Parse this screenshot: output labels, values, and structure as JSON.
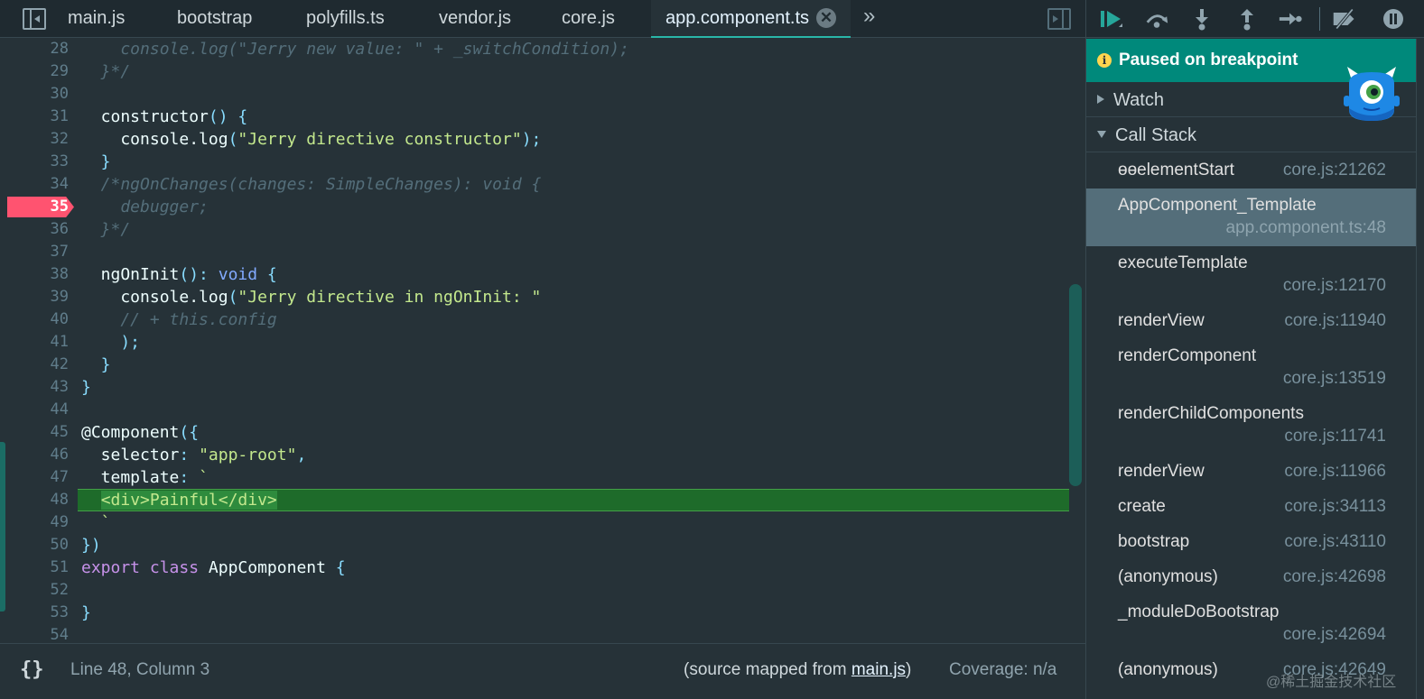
{
  "tabs": [
    {
      "label": "main.js"
    },
    {
      "label": "bootstrap"
    },
    {
      "label": "polyfills.ts"
    },
    {
      "label": "vendor.js"
    },
    {
      "label": "core.js"
    },
    {
      "label": "app.component.ts",
      "active": true,
      "close": "✕"
    }
  ],
  "tabs_more": "»",
  "editor": {
    "breakpoint_line": 35,
    "current_line": 48,
    "lines": [
      {
        "n": "28",
        "tokens": [
          [
            "cm",
            "    console.log(\"Jerry new value: \" + _switchCondition);"
          ]
        ]
      },
      {
        "n": "29",
        "tokens": [
          [
            "cm",
            "  }*/"
          ]
        ]
      },
      {
        "n": "30",
        "tokens": []
      },
      {
        "n": "31",
        "tokens": [
          [
            "fn",
            "  constructor"
          ],
          [
            "pn",
            "() {"
          ]
        ]
      },
      {
        "n": "32",
        "tokens": [
          [
            "fn",
            "    console.log"
          ],
          [
            "pn",
            "("
          ],
          [
            "str",
            "\"Jerry directive constructor\""
          ],
          [
            "pn",
            ");"
          ]
        ]
      },
      {
        "n": "33",
        "tokens": [
          [
            "pn",
            "  }"
          ]
        ]
      },
      {
        "n": "34",
        "tokens": [
          [
            "cm",
            "  /*ngOnChanges(changes: SimpleChanges): void {"
          ]
        ]
      },
      {
        "n": "35",
        "tokens": [
          [
            "cm",
            "    debugger;"
          ]
        ]
      },
      {
        "n": "36",
        "tokens": [
          [
            "cm",
            "  }*/"
          ]
        ]
      },
      {
        "n": "37",
        "tokens": []
      },
      {
        "n": "38",
        "tokens": [
          [
            "fn",
            "  ngOnInit"
          ],
          [
            "pn",
            "(): "
          ],
          [
            "ty",
            "void"
          ],
          [
            "pn",
            " {"
          ]
        ]
      },
      {
        "n": "39",
        "tokens": [
          [
            "fn",
            "    console.log"
          ],
          [
            "pn",
            "("
          ],
          [
            "str",
            "\"Jerry directive in ngOnInit: \""
          ]
        ]
      },
      {
        "n": "40",
        "tokens": [
          [
            "cm",
            "    // + this.config"
          ]
        ]
      },
      {
        "n": "41",
        "tokens": [
          [
            "pn",
            "    );"
          ]
        ]
      },
      {
        "n": "42",
        "tokens": [
          [
            "pn",
            "  }"
          ]
        ]
      },
      {
        "n": "43",
        "tokens": [
          [
            "pn",
            "}"
          ]
        ]
      },
      {
        "n": "44",
        "tokens": []
      },
      {
        "n": "45",
        "tokens": [
          [
            "fn",
            "@Component"
          ],
          [
            "pn",
            "({"
          ]
        ]
      },
      {
        "n": "46",
        "tokens": [
          [
            "prop",
            "  selector"
          ],
          [
            "pn",
            ": "
          ],
          [
            "str",
            "\"app-root\""
          ],
          [
            "pn",
            ","
          ]
        ]
      },
      {
        "n": "47",
        "tokens": [
          [
            "prop",
            "  template"
          ],
          [
            "pn",
            ": "
          ],
          [
            "str",
            "`"
          ]
        ]
      },
      {
        "n": "48",
        "tokens": [
          [
            "str",
            "  "
          ],
          [
            "exec",
            "<div>Painful</div>"
          ]
        ]
      },
      {
        "n": "49",
        "tokens": [
          [
            "str",
            "  `"
          ]
        ]
      },
      {
        "n": "50",
        "tokens": [
          [
            "pn",
            "})"
          ]
        ]
      },
      {
        "n": "51",
        "tokens": [
          [
            "kw",
            "export"
          ],
          [
            "pn",
            " "
          ],
          [
            "kw",
            "class"
          ],
          [
            "pn",
            " "
          ],
          [
            "fn",
            "AppComponent"
          ],
          [
            "pn",
            " {"
          ]
        ]
      },
      {
        "n": "52",
        "tokens": []
      },
      {
        "n": "53",
        "tokens": [
          [
            "pn",
            "}"
          ]
        ]
      },
      {
        "n": "54",
        "tokens": []
      }
    ]
  },
  "status": {
    "format_icon": "{}",
    "cursor": "Line 48, Column 3",
    "source_prefix": "(source mapped from ",
    "source_link": "main.js",
    "source_suffix": ")",
    "coverage": "Coverage: n/a"
  },
  "debugger": {
    "toolbar_icons": [
      "resume-icon",
      "step-over-icon",
      "step-into-icon",
      "step-out-icon",
      "step-icon",
      "deactivate-breakpoints-icon",
      "pause-on-exceptions-icon"
    ],
    "paused_icon": "i",
    "paused": "Paused on breakpoint",
    "watch": "Watch",
    "call_stack": "Call Stack",
    "frames": [
      {
        "fn": "ɵɵelementStart",
        "loc": "core.js:21262",
        "wrap": false
      },
      {
        "fn": "AppComponent_Template",
        "loc": "app.component.ts:48",
        "wrap": true,
        "selected": true
      },
      {
        "fn": "executeTemplate",
        "loc": "core.js:12170",
        "wrap": true
      },
      {
        "fn": "renderView",
        "loc": "core.js:11940",
        "wrap": false
      },
      {
        "fn": "renderComponent",
        "loc": "core.js:13519",
        "wrap": true
      },
      {
        "fn": "renderChildComponents",
        "loc": "core.js:11741",
        "wrap": true
      },
      {
        "fn": "renderView",
        "loc": "core.js:11966",
        "wrap": false
      },
      {
        "fn": "create",
        "loc": "core.js:34113",
        "wrap": false
      },
      {
        "fn": "bootstrap",
        "loc": "core.js:43110",
        "wrap": false
      },
      {
        "fn": "(anonymous)",
        "loc": "core.js:42698",
        "wrap": false
      },
      {
        "fn": "_moduleDoBootstrap",
        "loc": "core.js:42694",
        "wrap": true
      },
      {
        "fn": "(anonymous)",
        "loc": "core.js:42649",
        "wrap": false
      }
    ]
  },
  "watermark": "@稀土掘金技术社区",
  "colors": {
    "accent": "#00897b",
    "breakpoint": "#ff5370",
    "execution_line": "#1e6b2a"
  }
}
